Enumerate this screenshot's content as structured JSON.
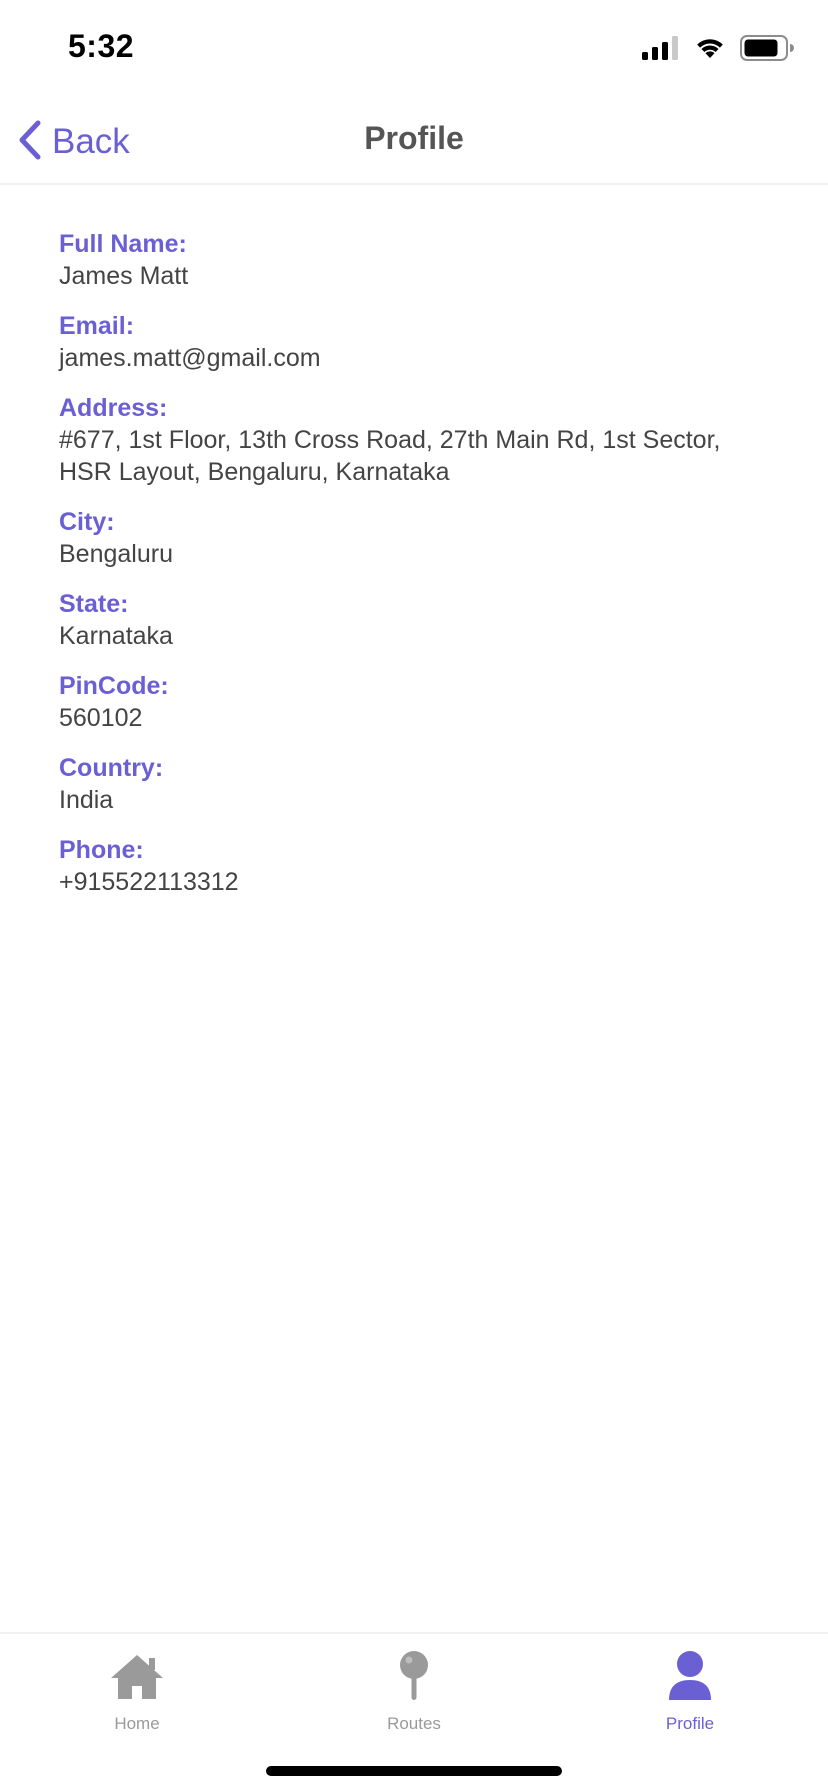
{
  "status_bar": {
    "time": "5:32",
    "icons": [
      "cellular-signal-icon",
      "wifi-icon",
      "battery-icon"
    ]
  },
  "nav": {
    "back_label": "Back",
    "title": "Profile"
  },
  "profile": {
    "fields": [
      {
        "label": "Full Name:",
        "value": "James Matt"
      },
      {
        "label": "Email:",
        "value": "james.matt@gmail.com"
      },
      {
        "label": "Address:",
        "value": "#677, 1st Floor, 13th Cross Road, 27th Main Rd, 1st Sector, HSR Layout, Bengaluru, Karnataka"
      },
      {
        "label": "City:",
        "value": "Bengaluru"
      },
      {
        "label": "State:",
        "value": "Karnataka"
      },
      {
        "label": "PinCode:",
        "value": "560102"
      },
      {
        "label": "Country:",
        "value": "India"
      },
      {
        "label": "Phone:",
        "value": "+915522113312"
      }
    ]
  },
  "tab_bar": {
    "tabs": [
      {
        "label": "Home",
        "icon": "home-icon",
        "active": false
      },
      {
        "label": "Routes",
        "icon": "map-pin-icon",
        "active": false
      },
      {
        "label": "Profile",
        "icon": "user-icon",
        "active": true
      }
    ]
  },
  "colors": {
    "accent": "#6b5fd4",
    "inactive": "#9a9a9a",
    "text": "#444444"
  }
}
